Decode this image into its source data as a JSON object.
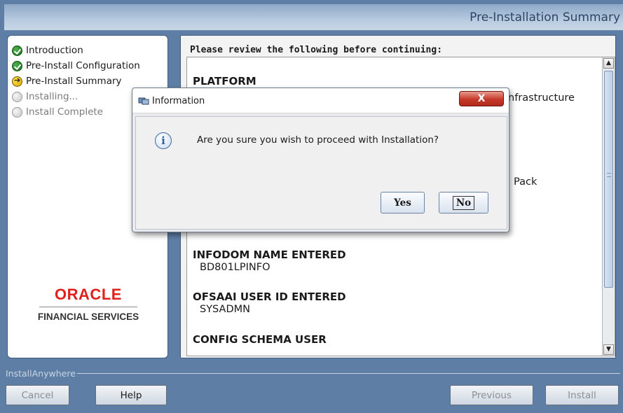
{
  "header": {
    "title": "Pre-Installation Summary"
  },
  "steps": [
    {
      "label": "Introduction",
      "state": "done"
    },
    {
      "label": "Pre-Install Configuration",
      "state": "done"
    },
    {
      "label": "Pre-Install Summary",
      "state": "current"
    },
    {
      "label": "Installing...",
      "state": "pending"
    },
    {
      "label": "Install Complete",
      "state": "pending"
    }
  ],
  "logo": {
    "brand": "ORACLE",
    "sub": "FINANCIAL SERVICES"
  },
  "summary": {
    "review_label": "Please review the following before continuing:",
    "platform_heading": "PLATFORM",
    "platform_partial": "nfrastructure",
    "pack_partial": "Pack",
    "infodom_heading": "INFODOM NAME ENTERED",
    "infodom_value": "BD801LPINFO",
    "userid_heading": "OFSAAI USER ID ENTERED",
    "userid_value": "SYSADMN",
    "config_heading": "CONFIG SCHEMA USER"
  },
  "footer": {
    "brand": "InstallAnywhere",
    "cancel": "Cancel",
    "help": "Help",
    "previous": "Previous",
    "install": "Install"
  },
  "dialog": {
    "title": "Information",
    "close": "X",
    "message": "Are you sure you wish to proceed with Installation?",
    "yes": "Yes",
    "no": "No"
  }
}
